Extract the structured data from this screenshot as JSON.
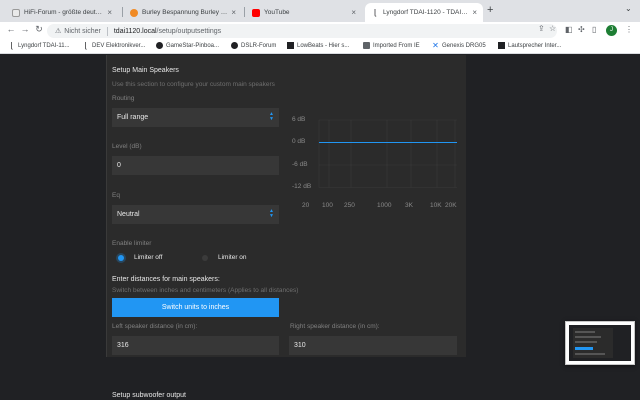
{
  "browser": {
    "tabs": [
      {
        "title": "HiFi-Forum - größte deutsche ...",
        "close": "×"
      },
      {
        "title": "Burley Bespannung Burley Ende...",
        "close": "×"
      },
      {
        "title": "YouTube",
        "close": "×"
      },
      {
        "title": "Lyngdorf TDAI-1120 - TDAI-112...",
        "close": "×"
      }
    ],
    "new_tab": "+",
    "address": {
      "security_label": "Nicht sicher",
      "host": "tdai1120.local",
      "path": "/setup/outputsettings"
    },
    "profile_initial": "J",
    "bookmarks": [
      {
        "label": "Lyngdorf TDAI-11..."
      },
      {
        "label": "DEV Elektronikver..."
      },
      {
        "label": "GameStar-Pinboa..."
      },
      {
        "label": "DSLR-Forum"
      },
      {
        "label": "LowBeats - Hier s..."
      },
      {
        "label": "Imported From IE"
      },
      {
        "label": "Genexis DRG05"
      },
      {
        "label": "Lautsprecher Inter..."
      }
    ],
    "colors": {
      "accent": "#2196f3",
      "panel": "#2b2b2b",
      "page": "#202124"
    }
  },
  "setup": {
    "title": "Setup Main Speakers",
    "description": "Use this section to configure your custom main speakers",
    "routing": {
      "label": "Routing",
      "value": "Full range"
    },
    "level": {
      "label": "Level (dB)",
      "value": "0"
    },
    "eq": {
      "label": "Eq",
      "value": "Neutral"
    },
    "limiter": {
      "label": "Enable limiter",
      "options": [
        {
          "label": "Limiter off",
          "selected": true
        },
        {
          "label": "Limiter on",
          "selected": false
        }
      ]
    },
    "distances": {
      "title": "Enter distances for main speakers:",
      "description": "Switch between inches and centimeters (Applies to all distances)",
      "switch_button": "Switch units to inches",
      "left_label": "Left speaker distance (in cm):",
      "left_value": "316",
      "right_label": "Right speaker distance (in cm):",
      "right_value": "310"
    }
  },
  "eq_graph": {
    "y_ticks": [
      "6 dB",
      "0 dB",
      "-6 dB",
      "-12 dB"
    ],
    "x_ticks": [
      "20",
      "100",
      "250",
      "1000",
      "3K",
      "10K",
      "20K"
    ],
    "response_db": 0
  },
  "subwoofer": {
    "title": "Setup subwoofer output"
  }
}
